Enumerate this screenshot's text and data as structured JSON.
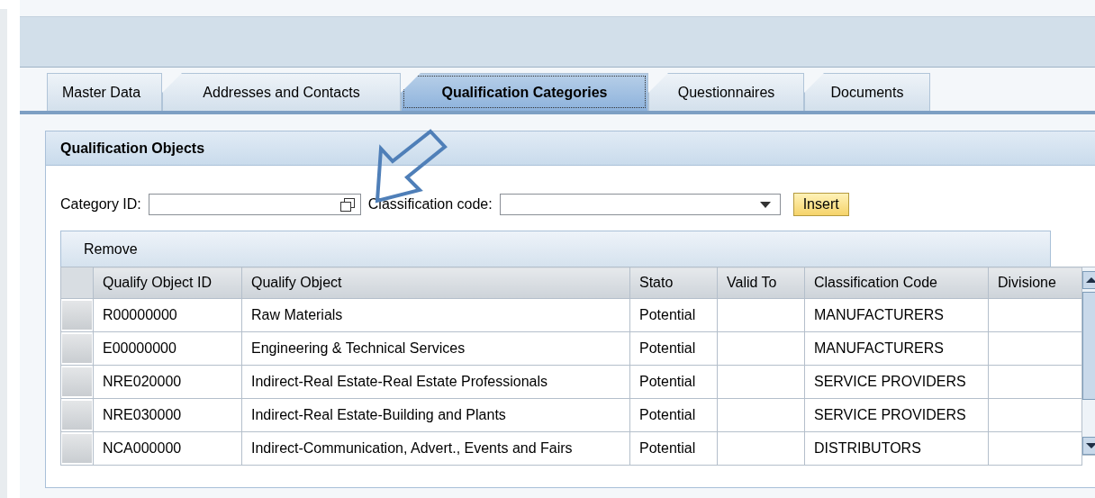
{
  "tabs": [
    {
      "label": "Master Data",
      "selected": false
    },
    {
      "label": "Addresses and Contacts",
      "selected": false
    },
    {
      "label": "Qualification Categories",
      "selected": true
    },
    {
      "label": "Questionnaires",
      "selected": false
    },
    {
      "label": "Documents",
      "selected": false
    }
  ],
  "panel": {
    "title": "Qualification Objects",
    "category_field": {
      "label": "Category ID:"
    },
    "classification_field": {
      "label": "Classification code:"
    },
    "insert_button": "Insert",
    "table": {
      "toolbar_button": "Remove",
      "columns": [
        "Qualify Object ID",
        "Qualify Object",
        "Stato",
        "Valid To",
        "Classification Code",
        "Divisione"
      ],
      "rows": [
        [
          "R00000000",
          "Raw Materials",
          "Potential",
          "",
          "MANUFACTURERS",
          ""
        ],
        [
          "E00000000",
          "Engineering & Technical Services",
          "Potential",
          "",
          "MANUFACTURERS",
          ""
        ],
        [
          "NRE020000",
          "Indirect-Real Estate-Real Estate Professionals",
          "Potential",
          "",
          "SERVICE PROVIDERS",
          ""
        ],
        [
          "NRE030000",
          "Indirect-Real Estate-Building and Plants",
          "Potential",
          "",
          "SERVICE PROVIDERS",
          ""
        ],
        [
          "NCA000000",
          "Indirect-Communication, Advert., Events and Fairs",
          "Potential",
          "",
          "DISTRIBUTORS",
          ""
        ]
      ]
    }
  }
}
